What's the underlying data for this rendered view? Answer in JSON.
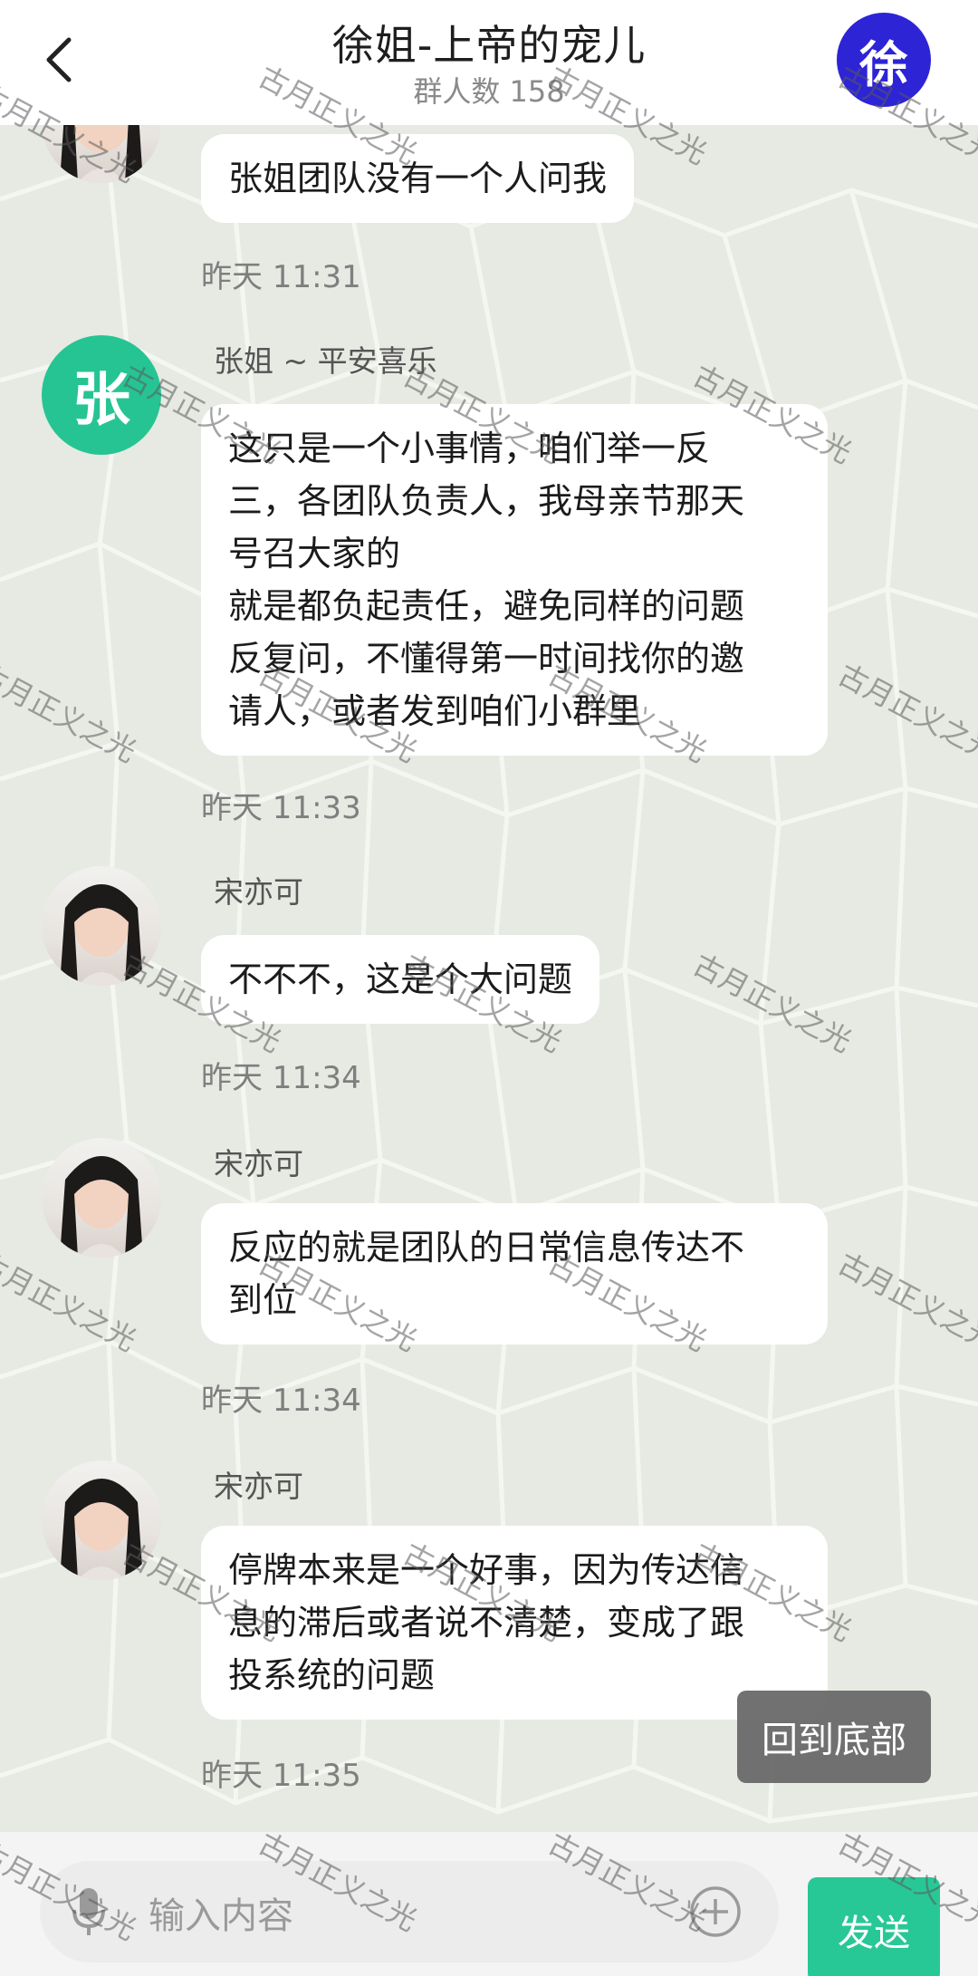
{
  "header": {
    "title": "徐姐-上帝的宠儿",
    "member_count": "群人数 158",
    "group_avatar_text": "徐"
  },
  "messages": [
    {
      "sender": "",
      "text": "张姐团队没有一个人问我",
      "time": "昨天 11:31"
    },
    {
      "sender": "张姐 ~ 平安喜乐",
      "avatar_text": "张",
      "lines": [
        "这只是一个小事情，咱们举一反",
        "三，各团队负责人，我母亲节那天",
        "号召大家的",
        "就是都负起责任，避免同样的问题",
        "反复问，不懂得第一时间找你的邀",
        "请人，或者发到咱们小群里"
      ],
      "time": "昨天 11:33"
    },
    {
      "sender": "宋亦可",
      "text": "不不不，这是个大问题",
      "time": "昨天 11:34"
    },
    {
      "sender": "宋亦可",
      "lines": [
        "反应的就是团队的日常信息传达不",
        "到位"
      ],
      "time": "昨天 11:34"
    },
    {
      "sender": "宋亦可",
      "lines": [
        "停牌本来是一个好事，因为传达信",
        "息的滞后或者说不清楚，变成了跟",
        "投系统的问题"
      ],
      "time": "昨天 11:35"
    }
  ],
  "back_to_bottom": "回到底部",
  "input": {
    "placeholder": "输入内容",
    "send_label": "发送"
  },
  "watermark": "古月正义之光",
  "colors": {
    "accent_green": "#28c896",
    "group_avatar": "#2d24d6"
  }
}
